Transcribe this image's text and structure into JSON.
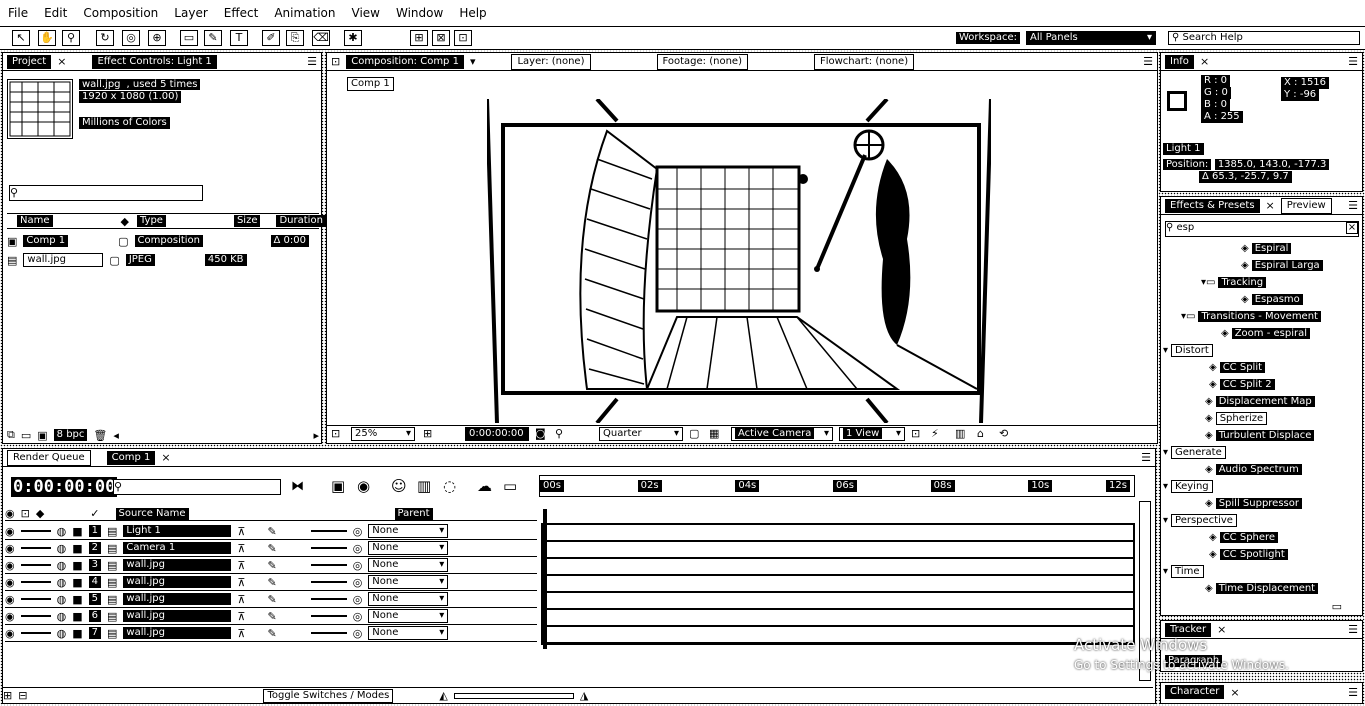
{
  "menu": [
    "File",
    "Edit",
    "Composition",
    "Layer",
    "Effect",
    "Animation",
    "View",
    "Window",
    "Help"
  ],
  "toolbar": {
    "workspace_label": "Workspace:",
    "workspace_value": "All Panels",
    "search_placeholder": "Search Help"
  },
  "project_panel": {
    "tabs": [
      "Project",
      "Effect Controls: Light 1"
    ],
    "file_name": "wall.jpg",
    "used": ", used 5 times",
    "dimensions": "1920 x 1080 (1.00)",
    "colors": "Millions of Colors",
    "columns": [
      "Name",
      "Type",
      "Size",
      "Duration"
    ],
    "items": [
      {
        "name": "Comp 1",
        "type": "Composition",
        "size": "",
        "duration": "Δ 0:00"
      },
      {
        "name": "wall.jpg",
        "type": "JPEG",
        "size": "450 KB",
        "duration": ""
      }
    ],
    "bpc": "8 bpc"
  },
  "composition_panel": {
    "tabs": [
      "Composition: Comp 1",
      "Layer: (none)",
      "Footage: (none)",
      "Flowchart: (none)"
    ],
    "comp_button": "Comp 1",
    "zoom": "25%",
    "timecode": "0:00:00:00",
    "resolution": "Quarter",
    "camera": "Active Camera",
    "views": "1 View"
  },
  "info_panel": {
    "tab": "Info",
    "r": "R : 0",
    "g": "G : 0",
    "b": "B : 0",
    "a": "A : 255",
    "x": "X : 1516",
    "y": "Y : -96",
    "light_name": "Light 1",
    "position_label": "Position:",
    "position_value": "1385.0, 143.0, -177.3",
    "delta_value": "Δ 65.3, -25.7, 9.7"
  },
  "effects_panel": {
    "tabs": [
      "Effects & Presets",
      "Preview"
    ],
    "search_value": "esp",
    "items": [
      {
        "label": "Espiral",
        "kind": "item",
        "indent": 80
      },
      {
        "label": "Espiral Larga",
        "kind": "item",
        "indent": 80
      },
      {
        "label": "Tracking",
        "kind": "folder",
        "indent": 40
      },
      {
        "label": "Espasmo",
        "kind": "item",
        "indent": 80
      },
      {
        "label": "Transitions - Movement",
        "kind": "folder",
        "indent": 20
      },
      {
        "label": "Zoom - espiral",
        "kind": "item",
        "indent": 60
      },
      {
        "label": "Distort",
        "kind": "cat",
        "indent": 2
      },
      {
        "label": "CC Split",
        "kind": "item",
        "indent": 48
      },
      {
        "label": "CC Split 2",
        "kind": "item",
        "indent": 48
      },
      {
        "label": "Displacement Map",
        "kind": "item",
        "indent": 44
      },
      {
        "label": "Spherize",
        "kind": "sel",
        "indent": 44
      },
      {
        "label": "Turbulent Displace",
        "kind": "item",
        "indent": 44
      },
      {
        "label": "Generate",
        "kind": "cat",
        "indent": 2
      },
      {
        "label": "Audio Spectrum",
        "kind": "item",
        "indent": 44
      },
      {
        "label": "Keying",
        "kind": "cat",
        "indent": 2
      },
      {
        "label": "Spill Suppressor",
        "kind": "item",
        "indent": 44
      },
      {
        "label": "Perspective",
        "kind": "cat",
        "indent": 2
      },
      {
        "label": "CC Sphere",
        "kind": "item",
        "indent": 48
      },
      {
        "label": "CC Spotlight",
        "kind": "item",
        "indent": 48
      },
      {
        "label": "Time",
        "kind": "cat",
        "indent": 2
      },
      {
        "label": "Time Displacement",
        "kind": "item",
        "indent": 44
      }
    ]
  },
  "tracker_panel": {
    "tab": "Tracker",
    "item": "Paragraph"
  },
  "character_panel": {
    "tab": "Character"
  },
  "timeline": {
    "tabs": [
      "Render Queue",
      "Comp 1"
    ],
    "timecode": "0:00:00:00",
    "source_name_header": "Source Name",
    "parent_header": "Parent",
    "ruler": [
      "00s",
      "02s",
      "04s",
      "06s",
      "08s",
      "10s",
      "12s"
    ],
    "layers": [
      {
        "num": "1",
        "name": "Light 1",
        "parent": "None"
      },
      {
        "num": "2",
        "name": "Camera 1",
        "parent": "None"
      },
      {
        "num": "3",
        "name": "wall.jpg",
        "parent": "None"
      },
      {
        "num": "4",
        "name": "wall.jpg",
        "parent": "None"
      },
      {
        "num": "5",
        "name": "wall.jpg",
        "parent": "None"
      },
      {
        "num": "6",
        "name": "wall.jpg",
        "parent": "None"
      },
      {
        "num": "7",
        "name": "wall.jpg",
        "parent": "None"
      }
    ],
    "toggle_label": "Toggle Switches / Modes"
  },
  "watermark": {
    "line1": "Activate Windows",
    "line2": "Go to Settings to activate Windows."
  }
}
